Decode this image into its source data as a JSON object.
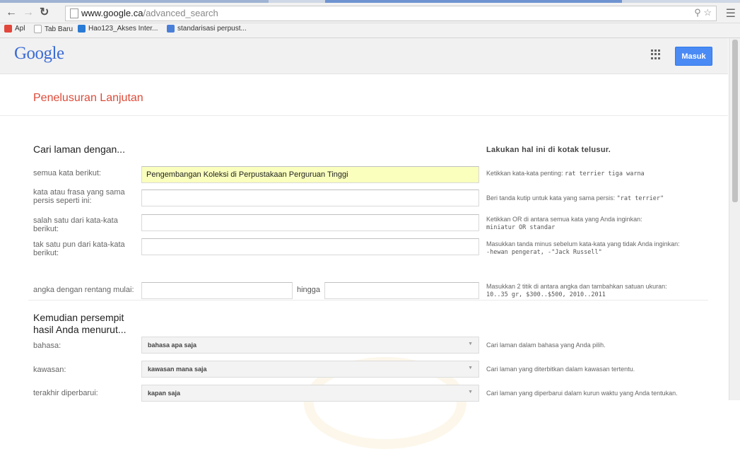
{
  "browser": {
    "url_host": "www.google.ca",
    "url_path": "/advanced_search",
    "bookmarks": [
      {
        "label": "Apl",
        "icon": "apps-grid-icon",
        "color": "#e2463a"
      },
      {
        "label": "Tab Baru",
        "icon": "page-icon",
        "color": "#dddddd"
      },
      {
        "label": "Hao123_Akses Inter...",
        "icon": "hao123-icon",
        "color": "#2a7bd4"
      },
      {
        "label": "standarisasi perpust...",
        "icon": "google-drive-icon",
        "color": "#4a7fd8"
      }
    ]
  },
  "header": {
    "logo": "Google",
    "signin_label": "Masuk",
    "signin_color": "#4a8af4"
  },
  "page_title": "Penelusuran Lanjutan",
  "section1": {
    "heading": "Cari laman dengan...",
    "hint_heading": "Lakukan hal ini di kotak telusur.",
    "rows": [
      {
        "label": "semua kata berikut:",
        "value": "Pengembangan Koleksi di Perpustakaan Perguruan Tinggi",
        "hint": "Ketikkan kata-kata penting:",
        "hint_code": "rat terrier tiga warna"
      },
      {
        "label": "kata atau frasa yang sama persis seperti ini:",
        "value": "",
        "hint": "Beri tanda kutip untuk kata yang sama persis:",
        "hint_code": "\"rat terrier\""
      },
      {
        "label": "salah satu dari kata-kata berikut:",
        "value": "",
        "hint": "Ketikkan OR di antara semua kata yang Anda inginkan:",
        "hint_code": "miniatur OR standar"
      },
      {
        "label": "tak satu pun dari kata-kata berikut:",
        "value": "",
        "hint": "Masukkan tanda minus sebelum kata-kata yang tidak Anda inginkan:",
        "hint_code": "-hewan pengerat, -\"Jack Russell\""
      }
    ],
    "range": {
      "label": "angka dengan rentang mulai:",
      "to_label": "hingga",
      "from_value": "",
      "to_value": "",
      "hint": "Masukkan 2 titik di antara angka dan tambahkan satuan ukuran:",
      "hint_code": "10..35 gr, $300..$500, 2010..2011"
    }
  },
  "section2": {
    "heading": "Kemudian persempit hasil Anda menurut...",
    "rows": [
      {
        "label": "bahasa:",
        "value": "bahasa apa saja",
        "hint": "Cari laman dalam bahasa yang Anda pilih."
      },
      {
        "label": "kawasan:",
        "value": "kawasan mana saja",
        "hint": "Cari laman yang diterbitkan dalam kawasan tertentu."
      },
      {
        "label": "terakhir diperbarui:",
        "value": "kapan saja",
        "hint": "Cari laman yang diperbarui dalam kurun waktu yang Anda tentukan."
      }
    ]
  },
  "colors": {
    "title_red": "#dd4b39",
    "autofill_yellow": "#faffbd",
    "logo_blue": "#3b6bd6"
  }
}
